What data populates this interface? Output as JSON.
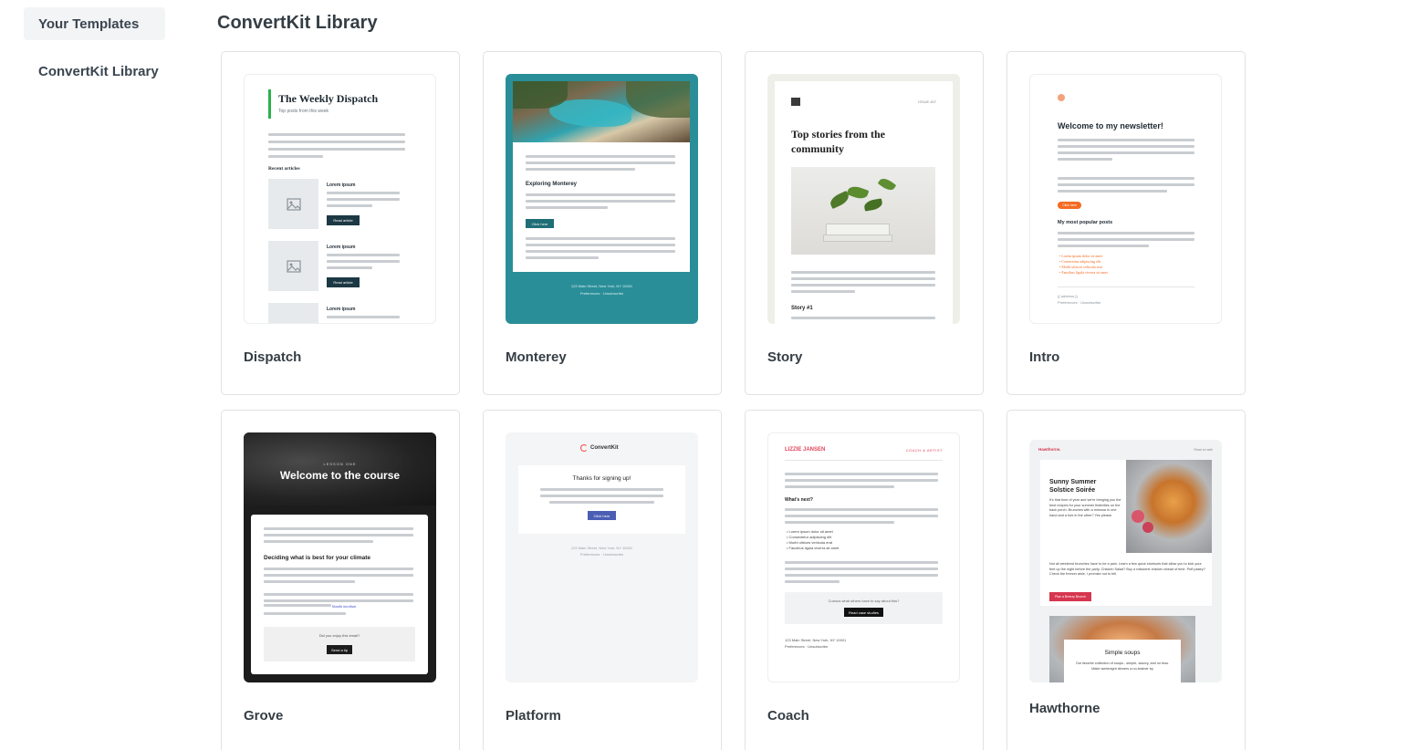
{
  "sidebar": {
    "items": [
      {
        "label": "Your Templates",
        "active": true
      },
      {
        "label": "ConvertKit Library",
        "active": false
      }
    ]
  },
  "page": {
    "title": "ConvertKit Library"
  },
  "templates": [
    {
      "name": "Dispatch"
    },
    {
      "name": "Monterey"
    },
    {
      "name": "Story"
    },
    {
      "name": "Intro"
    },
    {
      "name": "Grove"
    },
    {
      "name": "Platform"
    },
    {
      "name": "Coach"
    },
    {
      "name": "Hawthorne"
    }
  ],
  "previews": {
    "dispatch": {
      "title": "The Weekly Dispatch",
      "subtitle": "Top posts from this week",
      "section": "Recent articles",
      "item_title": "Lorem ipsum",
      "button": "Read article",
      "accent": "#2bb24c"
    },
    "monterey": {
      "heading": "Exploring Monterey",
      "button": "Click here",
      "address": "123 Main Street, New York, NY 10001",
      "links": "Preferences · Unsubscribe",
      "bg": "#2a8e98"
    },
    "story": {
      "meta": "ISSUE #07",
      "title": "Top stories from the community",
      "story": "Story #1"
    },
    "intro": {
      "title": "Welcome to my newsletter!",
      "button": "Click here",
      "section": "My most popular posts",
      "links": [
        "Lorem ipsum dolor sit amet",
        "Consectetur adipiscing elit",
        "Morbi ultrices vehicula erat",
        "Faucibus ligula viverra sit amet"
      ],
      "footer": "{{ address }}",
      "footer_links": "Preferences · Unsubscribe",
      "accent": "#f36b22"
    },
    "grove": {
      "kicker": "LESSON ONE",
      "title": "Welcome to the course",
      "heading": "Deciding what is best for your climate",
      "link": "blandit tincidunt",
      "question": "Did you enjoy this email?",
      "button": "Send a tip"
    },
    "platform": {
      "brand": "ConvertKit",
      "title": "Thanks for signing up!",
      "button": "Click here",
      "address": "123 Main Street, New York, NY 10001",
      "links": "Preferences · Unsubscribe"
    },
    "coach": {
      "name": "LIZZIE JANSEN",
      "tagline": "COACH & ARTIST",
      "heading": "What's next?",
      "bullets": [
        "Lorem ipsum dolor sit amet",
        "Consectetur adipiscing elit",
        "Morbi ultrices vehicula erat",
        "Faucibus ligula viverra sit amet"
      ],
      "question": "Curious what others have to say about this?",
      "button": "Read case studies",
      "address": "123 Main Street, New York, NY 10001",
      "links": "Preferences · Unsubscribe",
      "accent": "#e0455a"
    },
    "hawthorne": {
      "brand": "Hawthorne.",
      "read": "Read on web",
      "title": "Sunny Summer Solstice Soirée",
      "intro": "It's that time of year and we're bringing you the best recipes for your summer festivities on the back porch. Brunches with a mimosa in one hand and a fork in the other? Yes please.",
      "body": "Not all weekend brunches have to be a pain. Learn a few quick shortcuts that allow you to kick your feet up the night before the party. Chicken Salad? Buy a rotisserie chicken ahead of time. Puff pastry? Check the freezer aisle, I promise not to tell.",
      "button": "Plan a Breezy Brunch",
      "subtitle": "Simple soups",
      "sub_body": "Our favorite collection of soups - simple, savory, and no fuss. Make weeknight dinners a no-brainer by",
      "accent": "#d6364f"
    }
  }
}
